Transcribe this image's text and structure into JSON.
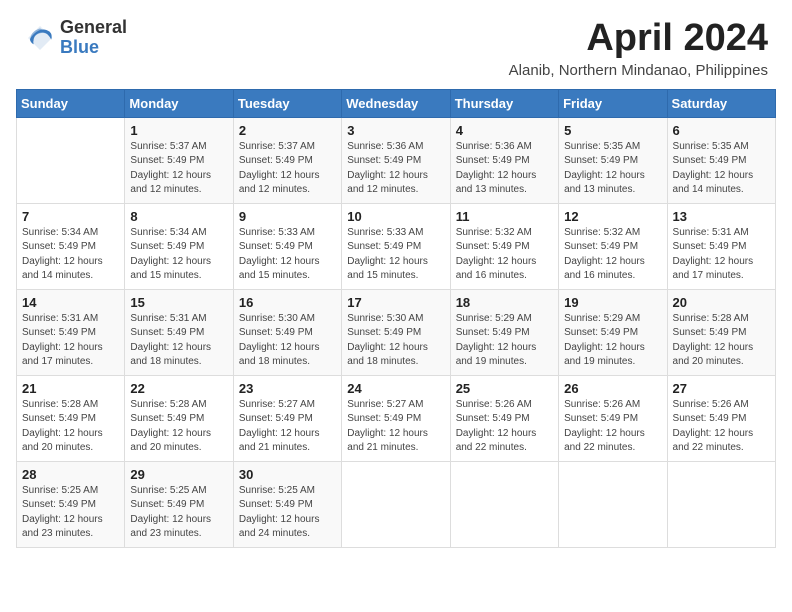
{
  "logo": {
    "general": "General",
    "blue": "Blue"
  },
  "header": {
    "month": "April 2024",
    "location": "Alanib, Northern Mindanao, Philippines"
  },
  "days_of_week": [
    "Sunday",
    "Monday",
    "Tuesday",
    "Wednesday",
    "Thursday",
    "Friday",
    "Saturday"
  ],
  "weeks": [
    [
      {
        "day": "",
        "info": ""
      },
      {
        "day": "1",
        "info": "Sunrise: 5:37 AM\nSunset: 5:49 PM\nDaylight: 12 hours\nand 12 minutes."
      },
      {
        "day": "2",
        "info": "Sunrise: 5:37 AM\nSunset: 5:49 PM\nDaylight: 12 hours\nand 12 minutes."
      },
      {
        "day": "3",
        "info": "Sunrise: 5:36 AM\nSunset: 5:49 PM\nDaylight: 12 hours\nand 12 minutes."
      },
      {
        "day": "4",
        "info": "Sunrise: 5:36 AM\nSunset: 5:49 PM\nDaylight: 12 hours\nand 13 minutes."
      },
      {
        "day": "5",
        "info": "Sunrise: 5:35 AM\nSunset: 5:49 PM\nDaylight: 12 hours\nand 13 minutes."
      },
      {
        "day": "6",
        "info": "Sunrise: 5:35 AM\nSunset: 5:49 PM\nDaylight: 12 hours\nand 14 minutes."
      }
    ],
    [
      {
        "day": "7",
        "info": "Sunrise: 5:34 AM\nSunset: 5:49 PM\nDaylight: 12 hours\nand 14 minutes."
      },
      {
        "day": "8",
        "info": "Sunrise: 5:34 AM\nSunset: 5:49 PM\nDaylight: 12 hours\nand 15 minutes."
      },
      {
        "day": "9",
        "info": "Sunrise: 5:33 AM\nSunset: 5:49 PM\nDaylight: 12 hours\nand 15 minutes."
      },
      {
        "day": "10",
        "info": "Sunrise: 5:33 AM\nSunset: 5:49 PM\nDaylight: 12 hours\nand 15 minutes."
      },
      {
        "day": "11",
        "info": "Sunrise: 5:32 AM\nSunset: 5:49 PM\nDaylight: 12 hours\nand 16 minutes."
      },
      {
        "day": "12",
        "info": "Sunrise: 5:32 AM\nSunset: 5:49 PM\nDaylight: 12 hours\nand 16 minutes."
      },
      {
        "day": "13",
        "info": "Sunrise: 5:31 AM\nSunset: 5:49 PM\nDaylight: 12 hours\nand 17 minutes."
      }
    ],
    [
      {
        "day": "14",
        "info": "Sunrise: 5:31 AM\nSunset: 5:49 PM\nDaylight: 12 hours\nand 17 minutes."
      },
      {
        "day": "15",
        "info": "Sunrise: 5:31 AM\nSunset: 5:49 PM\nDaylight: 12 hours\nand 18 minutes."
      },
      {
        "day": "16",
        "info": "Sunrise: 5:30 AM\nSunset: 5:49 PM\nDaylight: 12 hours\nand 18 minutes."
      },
      {
        "day": "17",
        "info": "Sunrise: 5:30 AM\nSunset: 5:49 PM\nDaylight: 12 hours\nand 18 minutes."
      },
      {
        "day": "18",
        "info": "Sunrise: 5:29 AM\nSunset: 5:49 PM\nDaylight: 12 hours\nand 19 minutes."
      },
      {
        "day": "19",
        "info": "Sunrise: 5:29 AM\nSunset: 5:49 PM\nDaylight: 12 hours\nand 19 minutes."
      },
      {
        "day": "20",
        "info": "Sunrise: 5:28 AM\nSunset: 5:49 PM\nDaylight: 12 hours\nand 20 minutes."
      }
    ],
    [
      {
        "day": "21",
        "info": "Sunrise: 5:28 AM\nSunset: 5:49 PM\nDaylight: 12 hours\nand 20 minutes."
      },
      {
        "day": "22",
        "info": "Sunrise: 5:28 AM\nSunset: 5:49 PM\nDaylight: 12 hours\nand 20 minutes."
      },
      {
        "day": "23",
        "info": "Sunrise: 5:27 AM\nSunset: 5:49 PM\nDaylight: 12 hours\nand 21 minutes."
      },
      {
        "day": "24",
        "info": "Sunrise: 5:27 AM\nSunset: 5:49 PM\nDaylight: 12 hours\nand 21 minutes."
      },
      {
        "day": "25",
        "info": "Sunrise: 5:26 AM\nSunset: 5:49 PM\nDaylight: 12 hours\nand 22 minutes."
      },
      {
        "day": "26",
        "info": "Sunrise: 5:26 AM\nSunset: 5:49 PM\nDaylight: 12 hours\nand 22 minutes."
      },
      {
        "day": "27",
        "info": "Sunrise: 5:26 AM\nSunset: 5:49 PM\nDaylight: 12 hours\nand 22 minutes."
      }
    ],
    [
      {
        "day": "28",
        "info": "Sunrise: 5:25 AM\nSunset: 5:49 PM\nDaylight: 12 hours\nand 23 minutes."
      },
      {
        "day": "29",
        "info": "Sunrise: 5:25 AM\nSunset: 5:49 PM\nDaylight: 12 hours\nand 23 minutes."
      },
      {
        "day": "30",
        "info": "Sunrise: 5:25 AM\nSunset: 5:49 PM\nDaylight: 12 hours\nand 24 minutes."
      },
      {
        "day": "",
        "info": ""
      },
      {
        "day": "",
        "info": ""
      },
      {
        "day": "",
        "info": ""
      },
      {
        "day": "",
        "info": ""
      }
    ]
  ]
}
